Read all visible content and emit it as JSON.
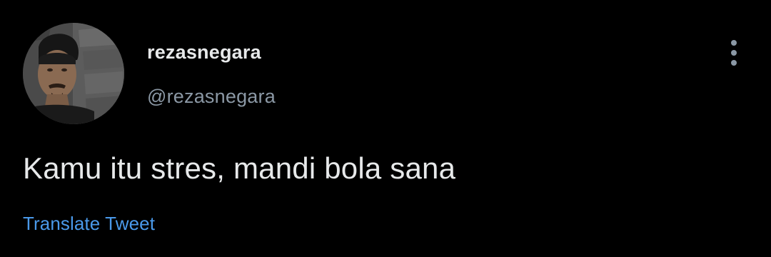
{
  "tweet": {
    "author": {
      "display_name": "rezasnegara",
      "handle": "@rezasnegara",
      "avatar": "profile-photo"
    },
    "text": "Kamu itu stres, mandi bola sana",
    "translate_label": "Translate Tweet",
    "more_icon": "more-vertical-icon"
  },
  "colors": {
    "background": "#000000",
    "primary_text": "#e7e9ea",
    "secondary_text": "#8b98a5",
    "link": "#4a99e9",
    "icon": "#8b98a5"
  }
}
